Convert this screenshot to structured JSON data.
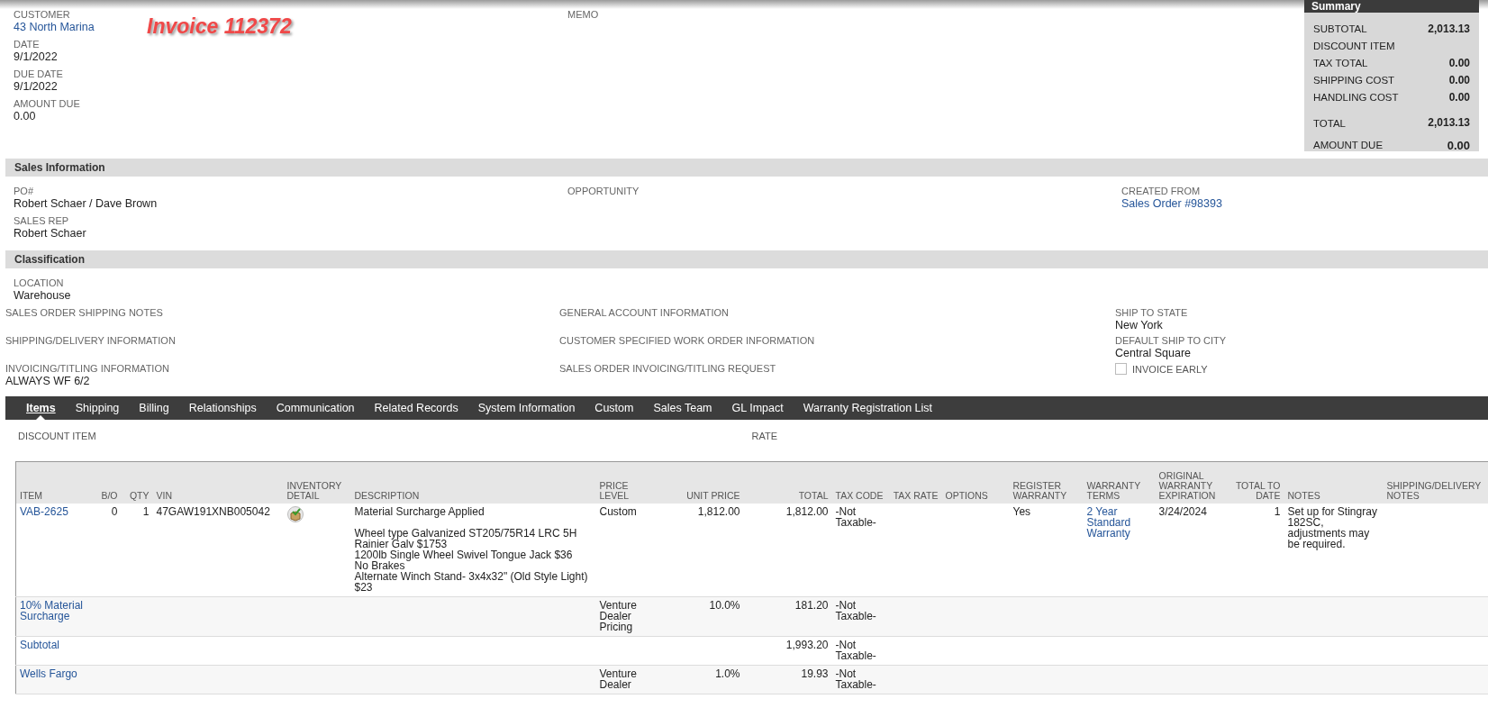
{
  "annotation": "Invoice 112372",
  "primary": {
    "left": [
      {
        "label": "CUSTOMER",
        "value": "43 North Marina",
        "kind": "link"
      },
      {
        "label": "DATE",
        "value": "9/1/2022",
        "kind": "text"
      },
      {
        "label": "DUE DATE",
        "value": "9/1/2022",
        "kind": "text"
      },
      {
        "label": "AMOUNT DUE",
        "value": "0.00",
        "kind": "text"
      }
    ],
    "middle": [
      {
        "label": "MEMO"
      }
    ]
  },
  "summary": {
    "title": "Summary",
    "rows": [
      {
        "label": "SUBTOTAL",
        "value": "2,013.13"
      },
      {
        "label": "DISCOUNT ITEM"
      },
      {
        "label": "TAX TOTAL",
        "value": "0.00"
      },
      {
        "label": "SHIPPING COST",
        "value": "0.00"
      },
      {
        "label": "HANDLING COST",
        "value": "0.00"
      },
      {
        "label": "TOTAL",
        "value": "2,013.13",
        "kind": "total"
      },
      {
        "label": "AMOUNT DUE",
        "value": "0.00",
        "kind": "due"
      }
    ]
  },
  "sales_information": {
    "title": "Sales Information",
    "columns": [
      [
        {
          "label": "PO#",
          "value": "Robert Schaer / Dave Brown",
          "kind": "text"
        },
        {
          "label": "SALES REP",
          "value": "Robert Schaer",
          "kind": "text"
        }
      ],
      [
        {
          "label": "OPPORTUNITY",
          "kind": "text"
        }
      ],
      [
        {
          "label": "CREATED FROM",
          "value": "Sales Order #98393",
          "kind": "link"
        }
      ]
    ]
  },
  "classification": {
    "title": "Classification",
    "fields": [
      {
        "label": "LOCATION",
        "value": "Warehouse"
      }
    ],
    "columns": [
      [
        {
          "label": "SALES ORDER SHIPPING NOTES",
          "kind": "text"
        },
        {
          "label": "SHIPPING/DELIVERY INFORMATION",
          "kind": "text"
        },
        {
          "label": "INVOICING/TITLING INFORMATION",
          "value": "ALWAYS WF 6/2",
          "kind": "text"
        }
      ],
      [
        {
          "label": "GENERAL ACCOUNT INFORMATION",
          "kind": "text"
        },
        {
          "label": "CUSTOMER SPECIFIED WORK ORDER INFORMATION",
          "kind": "text"
        },
        {
          "label": "SALES ORDER INVOICING/TITLING REQUEST",
          "kind": "text"
        }
      ],
      [
        {
          "label": "SHIP TO STATE",
          "value": "New York",
          "kind": "text"
        },
        {
          "label": "DEFAULT SHIP TO CITY",
          "value": "Central Square",
          "kind": "text"
        },
        {
          "label": "INVOICE EARLY",
          "kind": "checkbox",
          "checked": false
        }
      ]
    ]
  },
  "tabs": [
    {
      "label": "Items",
      "selected": true
    },
    {
      "label": "Shipping",
      "selected": false
    },
    {
      "label": "Billing",
      "selected": false
    },
    {
      "label": "Relationships",
      "selected": false
    },
    {
      "label": "Communication",
      "selected": false
    },
    {
      "label": "Related Records",
      "selected": false
    },
    {
      "label": "System Information",
      "selected": false
    },
    {
      "label": "Custom",
      "selected": false
    },
    {
      "label": "Sales Team",
      "selected": false
    },
    {
      "label": "GL Impact",
      "selected": false
    },
    {
      "label": "Warranty Registration List",
      "selected": false
    }
  ],
  "items_header": {
    "discount_item_label": "DISCOUNT ITEM",
    "rate_label": "RATE"
  },
  "table": {
    "columns": [
      "ITEM",
      "B/O",
      "QTY",
      "VIN",
      "INVENTORY DETAIL",
      "DESCRIPTION",
      "PRICE LEVEL",
      "UNIT PRICE",
      "TOTAL",
      "TAX CODE",
      "TAX RATE",
      "OPTIONS",
      "REGISTER WARRANTY",
      "WARRANTY TERMS",
      "ORIGINAL WARRANTY EXPIRATION",
      "TOTAL TO DATE",
      "NOTES",
      "SHIPPING/DELIVERY NOTES"
    ],
    "rows": [
      {
        "item": "VAB-2625",
        "bo": "0",
        "qty": "1",
        "vin": "47GAW191XNB005042",
        "inventory_detail": true,
        "description": "Material Surcharge Applied\n\nWheel type Galvanized ST205/75R14 LRC 5H Rainier Galv $1753\n1200lb Single Wheel Swivel Tongue Jack $36\nNo Brakes\nAlternate Winch Stand- 3x4x32\" (Old Style Light) $23",
        "price_level": "Custom",
        "unit_price": "1,812.00",
        "total": "1,812.00",
        "tax_code": "-Not Taxable-",
        "register_warranty": "Yes",
        "warranty_terms": "2 Year Standard Warranty",
        "original_warranty_expiration": "3/24/2024",
        "total_to_date": "1",
        "notes": "Set up for Stingray 182SC, adjustments may be required."
      },
      {
        "item": "10% Material Surcharge",
        "price_level": "Venture Dealer Pricing",
        "unit_price": "10.0%",
        "total": "181.20",
        "tax_code": "-Not Taxable-"
      },
      {
        "item": "Subtotal",
        "total": "1,993.20",
        "tax_code": "-Not Taxable-"
      },
      {
        "item": "Wells Fargo",
        "price_level": "Venture Dealer",
        "unit_price": "1.0%",
        "total": "19.93",
        "tax_code": "-Not Taxable-"
      }
    ]
  }
}
